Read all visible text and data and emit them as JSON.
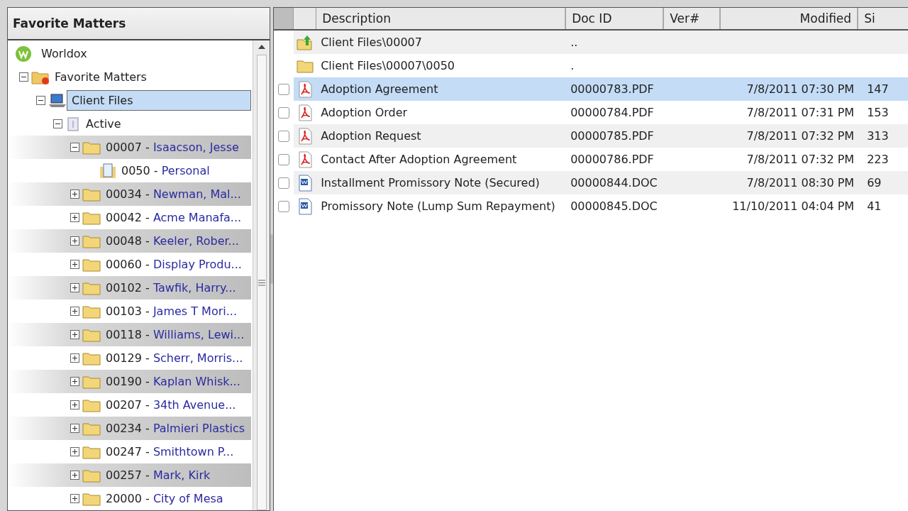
{
  "tree_panel": {
    "title": "Favorite Matters",
    "items": [
      {
        "kind": "worldox",
        "label": "Worldox",
        "selected": false,
        "children": [
          {
            "kind": "favorites",
            "label": "Favorite Matters",
            "expanded": true,
            "selected": false,
            "children": [
              {
                "kind": "computer",
                "label": "Client Files",
                "expanded": true,
                "selected": true,
                "children": [
                  {
                    "kind": "cabinet",
                    "label": "Active",
                    "expanded": true,
                    "selected": false,
                    "children": [
                      {
                        "kind": "folder",
                        "number": "00007",
                        "sep": "-",
                        "name": "Isaacson, Jesse",
                        "expanded": true,
                        "selected": false,
                        "children": [
                          {
                            "kind": "document",
                            "number": "0050",
                            "sep": "-",
                            "name": "Personal",
                            "selected": false
                          }
                        ]
                      },
                      {
                        "kind": "folder",
                        "number": "00034",
                        "sep": "-",
                        "name": "Newman, Mal...",
                        "expanded": false,
                        "selected": false
                      },
                      {
                        "kind": "folder",
                        "number": "00042",
                        "sep": "-",
                        "name": "Acme Manafa...",
                        "expanded": false,
                        "selected": false
                      },
                      {
                        "kind": "folder",
                        "number": "00048",
                        "sep": "-",
                        "name": "Keeler, Rober...",
                        "expanded": false,
                        "selected": false
                      },
                      {
                        "kind": "folder",
                        "number": "00060",
                        "sep": "-",
                        "name": "Display Produ...",
                        "expanded": false,
                        "selected": false
                      },
                      {
                        "kind": "folder",
                        "number": "00102",
                        "sep": "-",
                        "name": "Tawfik, Harry...",
                        "expanded": false,
                        "selected": false
                      },
                      {
                        "kind": "folder",
                        "number": "00103",
                        "sep": "-",
                        "name": "James T Mori...",
                        "expanded": false,
                        "selected": false
                      },
                      {
                        "kind": "folder",
                        "number": "00118",
                        "sep": "-",
                        "name": "Williams, Lewi...",
                        "expanded": false,
                        "selected": false
                      },
                      {
                        "kind": "folder",
                        "number": "00129",
                        "sep": "-",
                        "name": "Scherr, Morris...",
                        "expanded": false,
                        "selected": false
                      },
                      {
                        "kind": "folder",
                        "number": "00190",
                        "sep": "-",
                        "name": "Kaplan Whisk...",
                        "expanded": false,
                        "selected": false
                      },
                      {
                        "kind": "folder",
                        "number": "00207",
                        "sep": "-",
                        "name": "34th Avenue...",
                        "expanded": false,
                        "selected": false
                      },
                      {
                        "kind": "folder",
                        "number": "00234",
                        "sep": "-",
                        "name": "Palmieri Plastics",
                        "expanded": false,
                        "selected": false
                      },
                      {
                        "kind": "folder",
                        "number": "00247",
                        "sep": "-",
                        "name": "Smithtown P...",
                        "expanded": false,
                        "selected": false
                      },
                      {
                        "kind": "folder",
                        "number": "00257",
                        "sep": "-",
                        "name": "Mark, Kirk",
                        "expanded": false,
                        "selected": false
                      },
                      {
                        "kind": "folder",
                        "number": "20000",
                        "sep": "-",
                        "name": "City of Mesa",
                        "expanded": false,
                        "selected": false
                      }
                    ]
                  }
                ]
              }
            ]
          }
        ]
      }
    ]
  },
  "file_list": {
    "columns": [
      "Description",
      "Doc ID",
      "Ver#",
      "Modified",
      "Si"
    ],
    "rows": [
      {
        "kind": "parent-folder",
        "description": "Client Files\\00007",
        "doc_id": "..",
        "selected": false
      },
      {
        "kind": "folder",
        "description": "Client Files\\00007\\0050",
        "doc_id": ".",
        "selected": false
      },
      {
        "kind": "pdf",
        "description": "Adoption Agreement",
        "doc_id": "00000783.PDF",
        "modified": "7/8/2011 07:30 PM",
        "size": "147",
        "checked": false,
        "selected": true
      },
      {
        "kind": "pdf",
        "description": "Adoption Order",
        "doc_id": "00000784.PDF",
        "modified": "7/8/2011 07:31 PM",
        "size": "153",
        "checked": false,
        "selected": false
      },
      {
        "kind": "pdf",
        "description": "Adoption Request",
        "doc_id": "00000785.PDF",
        "modified": "7/8/2011 07:32 PM",
        "size": "313",
        "checked": false,
        "selected": false
      },
      {
        "kind": "pdf",
        "description": "Contact After Adoption Agreement",
        "doc_id": "00000786.PDF",
        "modified": "7/8/2011 07:32 PM",
        "size": "223",
        "checked": false,
        "selected": false
      },
      {
        "kind": "doc",
        "description": "Installment Promissory Note (Secured)",
        "doc_id": "00000844.DOC",
        "modified": "7/8/2011 08:30 PM",
        "size": "69",
        "checked": false,
        "selected": false
      },
      {
        "kind": "doc",
        "description": "Promissory Note (Lump Sum Repayment)",
        "doc_id": "00000845.DOC",
        "modified": "11/10/2011 04:04 PM",
        "size": "41",
        "checked": false,
        "selected": false
      }
    ]
  }
}
